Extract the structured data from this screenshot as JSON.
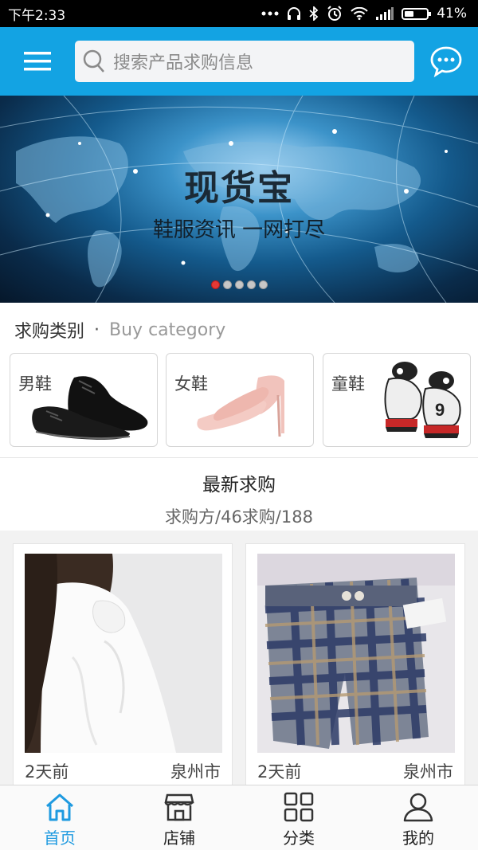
{
  "status_bar": {
    "time": "下午2:33",
    "battery": "41%"
  },
  "header": {
    "search_placeholder": "搜索产品求购信息"
  },
  "banner": {
    "title": "现货宝",
    "subtitle": "鞋服资讯 一网打尽",
    "slide_count": 5,
    "active_slide": 1
  },
  "category": {
    "title": "求购类别",
    "separator": "·",
    "title_en": "Buy category",
    "items": [
      {
        "label": "男鞋"
      },
      {
        "label": "女鞋"
      },
      {
        "label": "童鞋"
      }
    ]
  },
  "latest": {
    "title": "最新求购",
    "stats": "求购方/46求购/188"
  },
  "products": [
    {
      "time": "2天前",
      "city": "泉州市"
    },
    {
      "time": "2天前",
      "city": "泉州市"
    }
  ],
  "bottom_nav": [
    {
      "label": "首页",
      "icon": "home-icon",
      "active": true
    },
    {
      "label": "店铺",
      "icon": "store-icon",
      "active": false
    },
    {
      "label": "分类",
      "icon": "grid-icon",
      "active": false
    },
    {
      "label": "我的",
      "icon": "user-icon",
      "active": false
    }
  ],
  "colors": {
    "header": "#13a3e3",
    "nav_active": "#1e9ae0",
    "dot_active": "#e53935"
  }
}
